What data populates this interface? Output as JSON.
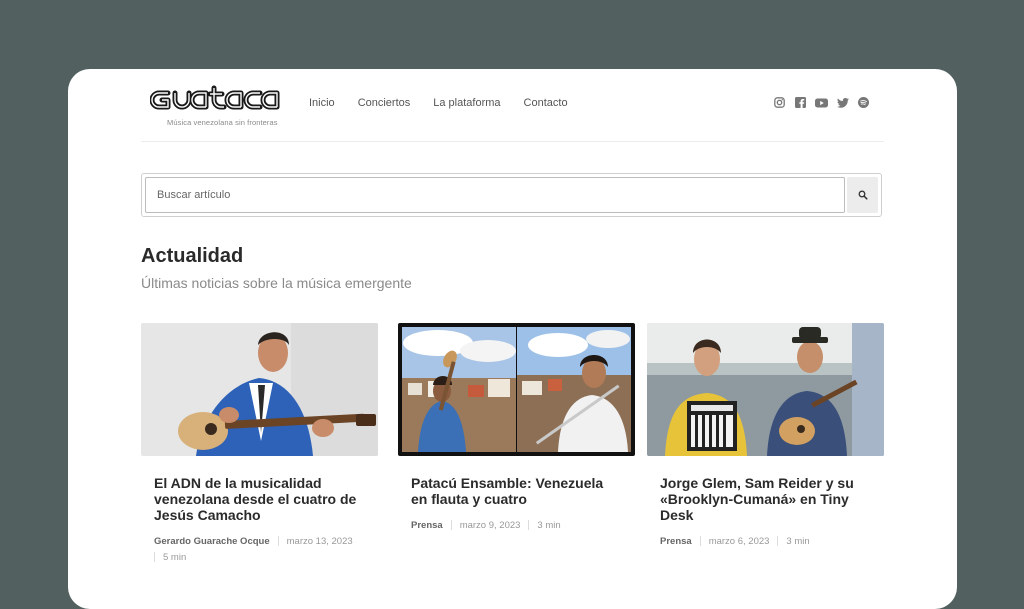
{
  "header": {
    "logo_text": "Guataca",
    "tagline": "Música venezolana sin fronteras",
    "nav": [
      {
        "label": "Inicio"
      },
      {
        "label": "Conciertos"
      },
      {
        "label": "La plataforma"
      },
      {
        "label": "Contacto"
      }
    ],
    "social": [
      "instagram-icon",
      "facebook-icon",
      "youtube-icon",
      "twitter-icon",
      "spotify-icon"
    ]
  },
  "search": {
    "placeholder": "Buscar artículo",
    "value": ""
  },
  "section": {
    "title": "Actualidad",
    "subtitle": "Últimas noticias sobre la música emergente"
  },
  "articles": [
    {
      "title": "El ADN de la musicalidad venezolana desde el cuatro de Jesús Camacho",
      "author": "Gerardo Guarache Ocque",
      "date": "marzo 13, 2023",
      "read_time": "5 min"
    },
    {
      "title": "Patacú Ensamble: Venezuela en flauta y cuatro",
      "author": "Prensa",
      "date": "marzo 9, 2023",
      "read_time": "3 min"
    },
    {
      "title": "Jorge Glem, Sam Reider y su «Brooklyn-Cumaná» en Tiny Desk",
      "author": "Prensa",
      "date": "marzo 6, 2023",
      "read_time": "3 min"
    }
  ],
  "colors": {
    "backdrop": "#526160",
    "panel": "#ffffff",
    "text": "#2b2b2b",
    "muted": "#8a8a8a"
  }
}
